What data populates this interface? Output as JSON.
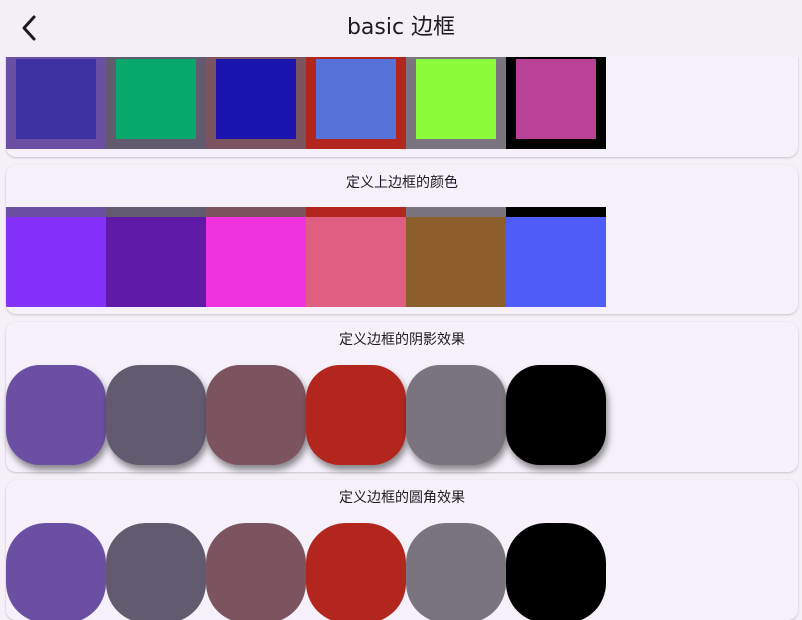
{
  "appbar": {
    "title": "basic 边框",
    "back_icon": "chevron-left-icon"
  },
  "section_border_color": {
    "tiles": [
      {
        "border": "#6a4fa3",
        "fill": "#3e32a2"
      },
      {
        "border": "#625a6f",
        "fill": "#08a86c"
      },
      {
        "border": "#7b545f",
        "fill": "#1b14ac"
      },
      {
        "border": "#b3261e",
        "fill": "#5573d8"
      },
      {
        "border": "#79747e",
        "fill": "#8cfc3a"
      },
      {
        "border": "#000000",
        "fill": "#b94196"
      }
    ]
  },
  "section_top_border": {
    "title": "定义上边框的颜色",
    "tiles": [
      {
        "border": "#6a4fa3",
        "fill": "#8432fb"
      },
      {
        "border": "#625a6f",
        "fill": "#5f1ba7"
      },
      {
        "border": "#7b545f",
        "fill": "#ef33de"
      },
      {
        "border": "#b3261e",
        "fill": "#e05e82"
      },
      {
        "border": "#79747e",
        "fill": "#8b5e2c"
      },
      {
        "border": "#000000",
        "fill": "#505cf8"
      }
    ]
  },
  "section_shadow": {
    "title": "定义边框的阴影效果",
    "tiles": [
      "#6a4fa3",
      "#625a6f",
      "#7b545f",
      "#b3261e",
      "#79747e",
      "#000000"
    ]
  },
  "section_radius": {
    "title": "定义边框的圆角效果",
    "tiles": [
      "#6a4fa3",
      "#625a6f",
      "#7b545f",
      "#b3261e",
      "#79747e",
      "#000000"
    ]
  }
}
